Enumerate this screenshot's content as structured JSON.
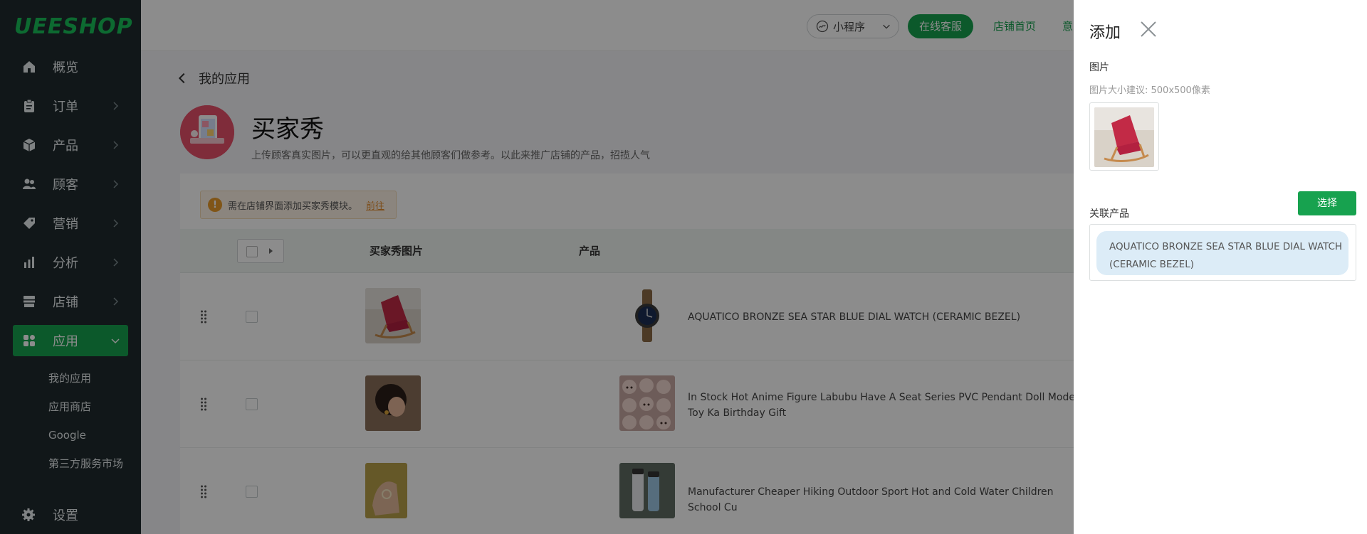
{
  "sidebar": {
    "logo": "UEESHOP",
    "items": [
      {
        "label": "概览",
        "icon": "home-icon"
      },
      {
        "label": "订单",
        "icon": "clipboard-icon"
      },
      {
        "label": "产品",
        "icon": "box-icon"
      },
      {
        "label": "顾客",
        "icon": "users-icon"
      },
      {
        "label": "营销",
        "icon": "tag-icon"
      },
      {
        "label": "分析",
        "icon": "bar-chart-icon"
      },
      {
        "label": "店铺",
        "icon": "store-icon"
      },
      {
        "label": "应用",
        "icon": "apps-grid-icon"
      }
    ],
    "subitems": [
      "我的应用",
      "应用商店",
      "Google",
      "第三方服务市场"
    ],
    "settings_label": "设置"
  },
  "topbar": {
    "miniprogram_label": "小程序",
    "service_label": "在线客服",
    "store_home_label": "店铺首页",
    "truncated_label": "意"
  },
  "page": {
    "back_label": "我的应用",
    "title": "买家秀",
    "description": "上传顾客真实图片，可以更直观的给其他顾客们做参考。以此来推广店铺的产品，招揽人气",
    "notice_text": "需在店铺界面添加买家秀模块。",
    "notice_link": "前往",
    "table_headers": {
      "image": "买家秀图片",
      "product": "产品"
    },
    "rows": [
      {
        "product_name": "AQUATICO BRONZE SEA STAR BLUE DIAL WATCH (CERAMIC BEZEL)"
      },
      {
        "product_name": "In Stock Hot Anime Figure Labubu Have A Seat Series PVC Pendant Doll Model Toy Ka Birthday Gift"
      },
      {
        "product_name": "Manufacturer Cheaper Hiking Outdoor Sport Hot and Cold Water Children School Cu"
      }
    ]
  },
  "drawer": {
    "title": "添加",
    "image_label": "图片",
    "image_hint": "图片大小建议: 500x500像素",
    "product_label": "关联产品",
    "select_button": "选择",
    "selected_product": "AQUATICO BRONZE SEA STAR BLUE DIAL WATCH (CERAMIC BEZEL)"
  },
  "colors": {
    "brand_green": "#17a24f",
    "sidebar_bg": "#1f2a2e",
    "tag_bg": "#dcecf7",
    "warn_orange": "#e99b2b"
  }
}
